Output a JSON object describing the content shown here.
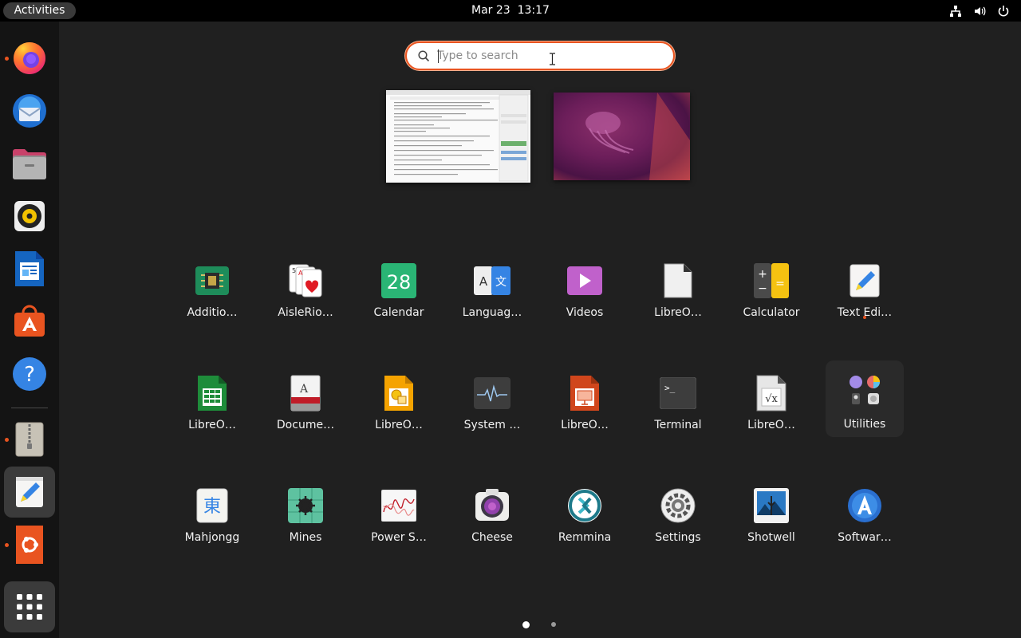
{
  "topbar": {
    "activities": "Activities",
    "date": "Mar 23",
    "time": "13:17",
    "tray_icons": [
      "network-icon",
      "volume-icon",
      "power-icon"
    ]
  },
  "search": {
    "placeholder": "Type to search",
    "value": ""
  },
  "dock": {
    "items": [
      {
        "name": "Firefox",
        "icon": "firefox-icon",
        "running": true
      },
      {
        "name": "Thunderbird",
        "icon": "thunderbird-icon",
        "running": false
      },
      {
        "name": "Files",
        "icon": "files-icon",
        "running": false
      },
      {
        "name": "Rhythmbox",
        "icon": "rhythmbox-icon",
        "running": false
      },
      {
        "name": "LibreOffice Writer",
        "icon": "writer-icon",
        "running": false
      },
      {
        "name": "Ubuntu Software",
        "icon": "software-icon",
        "running": false
      },
      {
        "name": "Help",
        "icon": "help-icon",
        "running": false
      },
      {
        "name": "Archive Manager",
        "icon": "archive-icon",
        "running": true
      },
      {
        "name": "Text Editor",
        "icon": "text-editor-icon",
        "running": true
      },
      {
        "name": "Ubuntu",
        "icon": "ubuntu-icon",
        "running": true
      },
      {
        "name": "Show Applications",
        "icon": "app-grid-icon",
        "running": false
      }
    ]
  },
  "apps": {
    "row1": [
      "Additio…",
      "AisleRio…",
      "Calendar",
      "Languag…",
      "Videos",
      "LibreO…",
      "Calculator",
      "Text Edi…"
    ],
    "row2": [
      "LibreO…",
      "Docume…",
      "LibreO…",
      "System …",
      "LibreO…",
      "Terminal",
      "LibreO…",
      "Utilities"
    ],
    "row3": [
      "Mahjongg",
      "Mines",
      "Power S…",
      "Cheese",
      "Remmina",
      "Settings",
      "Shotwell",
      "Softwar…"
    ],
    "calendar_day": "28",
    "mahjongg_glyph": "東",
    "terminal_prompt": ">_"
  },
  "pager": {
    "pages": 2,
    "current": 1
  },
  "colors": {
    "accent": "#e95420",
    "background": "#202020",
    "dock": "#141414"
  }
}
